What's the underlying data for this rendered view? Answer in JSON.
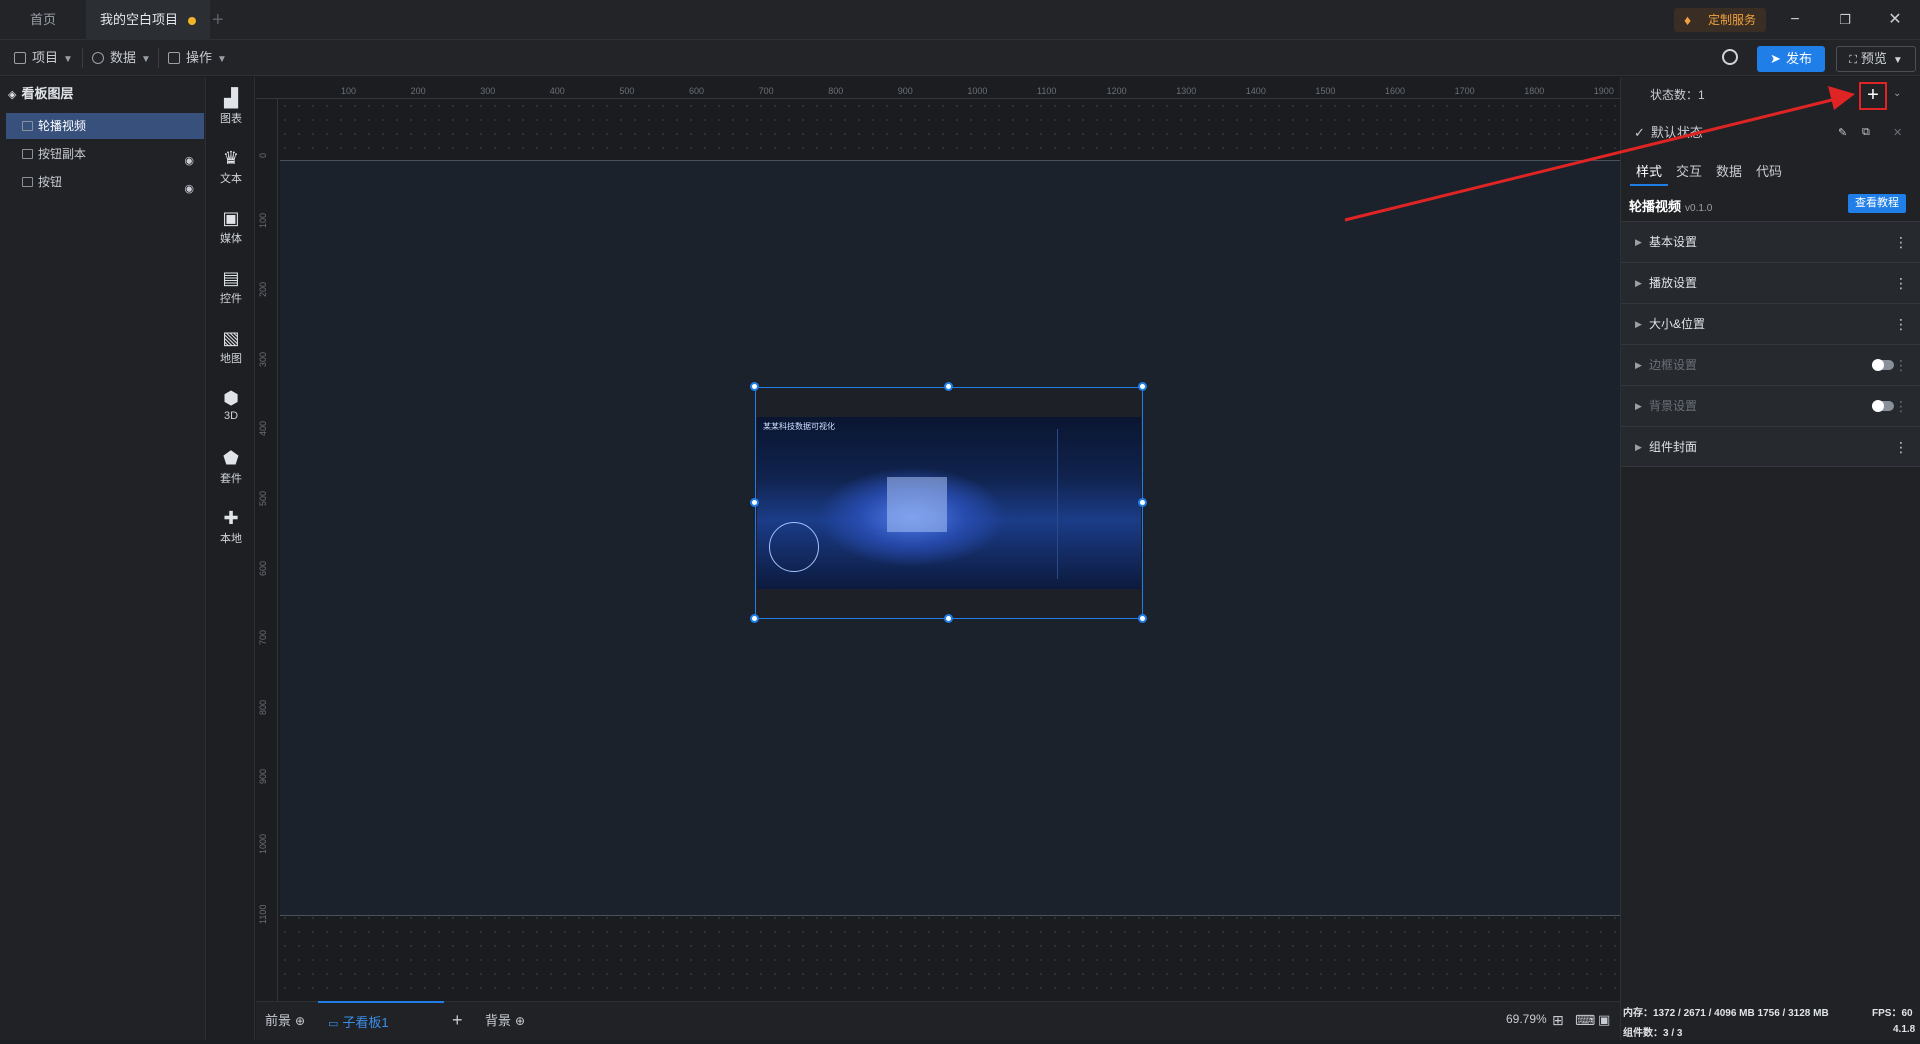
{
  "tabs": [
    {
      "label": "首页"
    },
    {
      "label": "我的空白项目"
    }
  ],
  "custom_service": "定制服务",
  "toolbar": {
    "project": "项目",
    "data": "数据",
    "operate": "操作",
    "publish": "发布",
    "preview": "预览"
  },
  "layers": {
    "title": "看板图层",
    "items": [
      {
        "label": "轮播视频"
      },
      {
        "label": "按钮副本"
      },
      {
        "label": "按钮"
      }
    ]
  },
  "components": [
    "图表",
    "文本",
    "媒体",
    "控件",
    "地图",
    "3D",
    "套件",
    "本地"
  ],
  "ruler": {
    "top": [
      "100",
      "200",
      "300",
      "400",
      "500",
      "600",
      "700",
      "800",
      "900",
      "1000",
      "1100",
      "1200",
      "1300",
      "1400",
      "1500",
      "1600",
      "1700",
      "1800",
      "1900"
    ],
    "left": [
      "0",
      "100",
      "200",
      "300",
      "400",
      "500",
      "600",
      "700",
      "800",
      "900",
      "1000",
      "1100"
    ]
  },
  "video": {
    "title": "某某科技数据可视化"
  },
  "statusbar": {
    "foreground": "前景",
    "sub_board": "子看板1",
    "background": "背景",
    "zoom": "69.79%"
  },
  "right_panel": {
    "state_count": "状态数：1",
    "default_state": "默认状态",
    "tabs": [
      "样式",
      "交互",
      "数据",
      "代码"
    ],
    "component_name": "轮播视频",
    "component_version": "v0.1.0",
    "tutorial": "查看教程",
    "sections": [
      {
        "label": "基本设置"
      },
      {
        "label": "播放设置"
      },
      {
        "label": "大小&位置"
      },
      {
        "label": "边框设置"
      },
      {
        "label": "背景设置"
      },
      {
        "label": "组件封面"
      }
    ]
  },
  "footer": {
    "memory": "内存：1372 / 2671 / 4096 MB  1756 / 3128 MB",
    "fps": "FPS：60",
    "component_count": "组件数：3 / 3",
    "version": "4.1.8"
  },
  "colors": {
    "accent": "#1f7ee8",
    "annotation": "#e02424"
  }
}
